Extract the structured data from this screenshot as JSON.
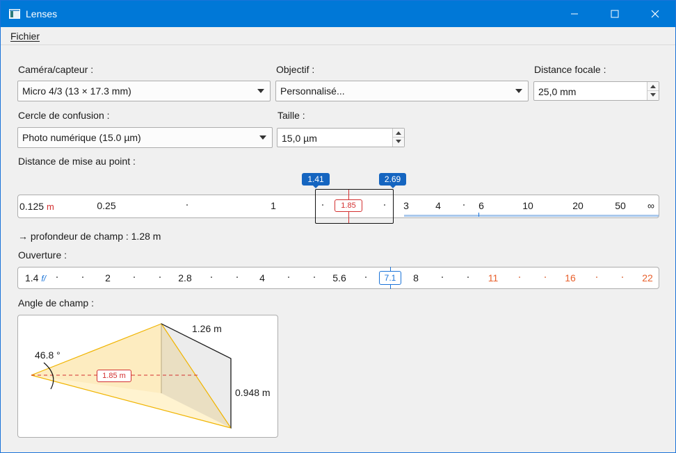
{
  "window": {
    "title": "Lenses"
  },
  "menu": {
    "file": "Fichier"
  },
  "camera": {
    "label": "Caméra/capteur :",
    "value": "Micro 4/3 (13 × 17.3 mm)"
  },
  "lens": {
    "label": "Objectif :",
    "value": "Personnalisé..."
  },
  "focal": {
    "label": "Distance focale :",
    "value": "25,0 mm"
  },
  "coc": {
    "label": "Cercle de confusion :",
    "value": "Photo numérique (15.0 µm)"
  },
  "size": {
    "label": "Taille :",
    "value": "15,0 µm"
  },
  "focus": {
    "label": "Distance de mise au point :",
    "near": "1.41",
    "far": "2.69",
    "current": "1.85",
    "first_tick": "0.125",
    "unit": "m",
    "ticks": [
      "0.25",
      "1",
      "3",
      "4",
      "6",
      "10",
      "20",
      "50",
      "∞"
    ]
  },
  "dof": {
    "text": "→ profondeur de champ : 1.28 m"
  },
  "aperture": {
    "label": "Ouverture :",
    "first": "1.4",
    "prefix": "f/",
    "current": "7.1",
    "ticks": [
      "2",
      "2.8",
      "4",
      "5.6",
      "8"
    ],
    "ticks_warn": [
      "11",
      "16",
      "22"
    ],
    "warn_color": "#e8602c"
  },
  "fov": {
    "label": "Angle de champ :",
    "angle": "46.8 °",
    "width": "1.26 m",
    "height": "0.948 m",
    "distance": "1.85 m"
  },
  "colors": {
    "accent": "#0078d7",
    "focus": "#d32f2f",
    "pill": "#1565c0",
    "cone": "#fff2cc"
  }
}
